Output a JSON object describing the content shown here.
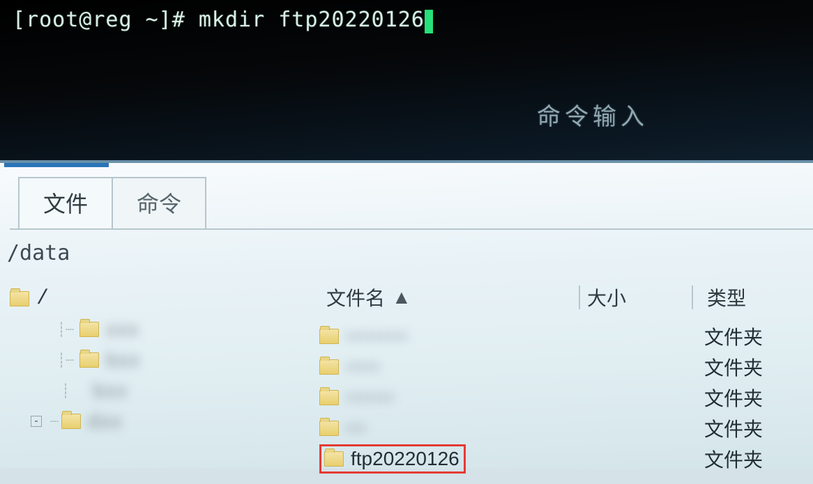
{
  "terminal": {
    "line": "[root@reg ~]# mkdir ftp20220126",
    "hint": "命令输入"
  },
  "tabs": {
    "file": "文件",
    "cmd": "命令"
  },
  "path": "/data",
  "tree": {
    "root": "/",
    "items": [
      "xxx",
      "bxx",
      "bxx",
      "dxx"
    ]
  },
  "list": {
    "headers": {
      "name": "文件名",
      "size": "大小",
      "type": "类型"
    },
    "rows": [
      {
        "name": "xxxxxxxxx",
        "type": "文件夹",
        "blurred": true
      },
      {
        "name": "xxxxx",
        "type": "文件夹",
        "blurred": true
      },
      {
        "name": "xxxxxxx",
        "type": "文件夹",
        "blurred": true
      },
      {
        "name": "xxx",
        "type": "文件夹",
        "blurred": true
      },
      {
        "name": "ftp20220126",
        "type": "文件夹",
        "blurred": false,
        "highlight": true
      }
    ]
  }
}
